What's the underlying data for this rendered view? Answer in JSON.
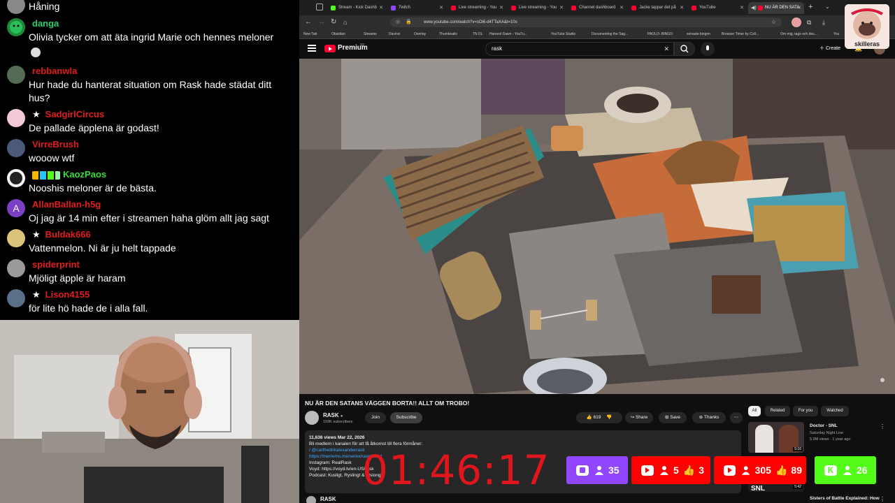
{
  "chat": {
    "messages": [
      {
        "user": "",
        "text": "Håning",
        "color": "#ff4d4d",
        "star": false,
        "badge": ""
      },
      {
        "user": "danga",
        "text": "Olivia tycker om att äta ingrid Marie och hennes meloner",
        "color": "#2ecc71",
        "star": false,
        "badge": ""
      },
      {
        "user": "rebbanwla",
        "text": "Hur hade du hanterat situation om Rask hade städat ditt hus?",
        "color": "#e11d1d",
        "star": false,
        "badge": ""
      },
      {
        "user": "SadgirlCircus",
        "text": "De pallade äpplena är godast!",
        "color": "#e11d1d",
        "star": true,
        "badge": ""
      },
      {
        "user": "VirreBrush",
        "text": "wooow wtf",
        "color": "#e11d1d",
        "star": false,
        "badge": ""
      },
      {
        "user": "KaozPaos",
        "text": "Nooshis meloner är de bästa.",
        "color": "#3ddc3d",
        "star": false,
        "badge": "badges"
      },
      {
        "user": "AllanBallan-h5g",
        "text": "Oj jag är 14 min efter i streamen haha glöm allt jag sagt",
        "color": "#e11d1d",
        "star": false,
        "badge": "",
        "avatar_letter": "A"
      },
      {
        "user": "Buldak666",
        "text": "Vattenmelon. Ni är ju helt tappade",
        "color": "#e11d1d",
        "star": true,
        "badge": ""
      },
      {
        "user": "spiderprint",
        "text": "Mjöligt äpple är haram",
        "color": "#e11d1d",
        "star": false,
        "badge": ""
      },
      {
        "user": "Lison4155",
        "text": "för lite hö hade de i alla fall.",
        "color": "#e11d1d",
        "star": true,
        "badge": ""
      }
    ]
  },
  "browser": {
    "tabs": [
      {
        "label": "Stream - Kick Dashb",
        "icon_color": "#53fc18"
      },
      {
        "label": "Twitch",
        "icon_color": "#9146ff"
      },
      {
        "label": "Live streaming - You",
        "icon_color": "#ff0033"
      },
      {
        "label": "Live streaming - You",
        "icon_color": "#ff0033"
      },
      {
        "label": "Channel dashboard",
        "icon_color": "#ff0033"
      },
      {
        "label": "Jacke tappar det på",
        "icon_color": "#ff0033"
      },
      {
        "label": "YouTube",
        "icon_color": "#ff0033"
      },
      {
        "label": "NU ÄR DEN SATA",
        "icon_color": "#ff0033"
      }
    ],
    "url": "www.youtube.com/watch?v=sOi6-d4TTaXA&t=10s",
    "bookmarks": [
      "New Tab",
      "Obsidian",
      "Streams",
      "Davinci",
      "Overlay",
      "Thumbnails",
      "TN DL",
      "Harvest Dawn - YouTu...",
      "YouTube Studio",
      "Documenting the Sag...",
      "PAOLO- BINGO",
      "senaste bingon",
      "Browser Timer by Coll...",
      "Om mig, tags och des...",
      "You"
    ]
  },
  "youtube": {
    "brand": "Premium",
    "brand_region": "SE",
    "search_query": "rask",
    "create_label": "Create",
    "video_title": "NU ÄR DEN SATANS VÄGGEN BORTA!! ALLT OM TROBO!",
    "channel_name": "RASK",
    "subscribers": "159K subscribers",
    "join_label": "Join",
    "subscribe_label": "Subscribe",
    "likes": "619",
    "share_label": "Share",
    "save_label": "Save",
    "thanks_label": "Thanks",
    "description": {
      "line1": "11,636 views  Mar 22, 2026",
      "line2": "Bli medlem i kanalen för att få åtkomst till flera förmåner:",
      "line3": "/ @carlfredrikalexanderrask",
      "line4": "https://merrems.me/se/ex/rask/cart-f",
      "line5": "Instagram: RealRask",
      "line6": "Voyd: https://voyd.tv/en-US/rask",
      "line7": "Podcast: Kusligt, Ryslingt & Visiongt"
    },
    "comments_channel": "RASK",
    "chips": [
      "All",
      "Related",
      "For you",
      "Watched"
    ],
    "recommendations": [
      {
        "title": "Doctor - SNL",
        "channel": "Saturday Night Live",
        "meta": "5.9M views · 1 year ago",
        "duration": "5:16"
      },
      {
        "title": "Sisters of Battle Explained: How",
        "channel": "",
        "meta": "",
        "duration": "5:42"
      }
    ]
  },
  "overlay": {
    "timer": "01:46:17",
    "viewer_counts": [
      {
        "platform": "twitch",
        "viewers": "35",
        "likes": "",
        "color": "#9146ff"
      },
      {
        "platform": "youtube",
        "viewers": "5",
        "likes": "3",
        "color": "#ff0000"
      },
      {
        "platform": "youtube",
        "viewers": "305",
        "likes": "89",
        "color": "#ff0000"
      },
      {
        "platform": "kick",
        "viewers": "26",
        "likes": "",
        "color": "#53fc18"
      }
    ],
    "logo_text": "skilleras"
  }
}
